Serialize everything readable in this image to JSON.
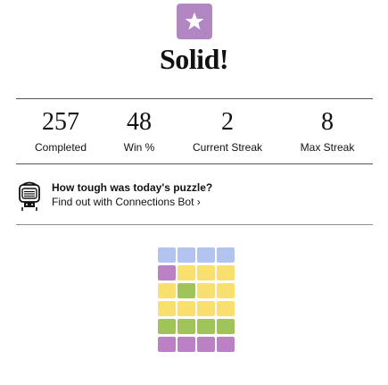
{
  "colors": {
    "yellow": "#f9df6d",
    "green": "#a0c35a",
    "blue": "#b0c4ef",
    "purple": "#ba81c5",
    "badge": "#b286c3"
  },
  "badge": {
    "icon": "star-icon"
  },
  "result_title": "Solid!",
  "stats": [
    {
      "value": "257",
      "label": "Completed"
    },
    {
      "value": "48",
      "label": "Win %"
    },
    {
      "value": "2",
      "label": "Current Streak"
    },
    {
      "value": "8",
      "label": "Max Streak"
    }
  ],
  "bot": {
    "icon": "robot-icon",
    "question": "How tough was today's puzzle?",
    "link_text": "Find out with Connections Bot ›"
  },
  "guess_grid": [
    [
      "blue",
      "blue",
      "blue",
      "blue"
    ],
    [
      "purple",
      "yellow",
      "yellow",
      "yellow"
    ],
    [
      "yellow",
      "green",
      "yellow",
      "yellow"
    ],
    [
      "yellow",
      "yellow",
      "yellow",
      "yellow"
    ],
    [
      "green",
      "green",
      "green",
      "green"
    ],
    [
      "purple",
      "purple",
      "purple",
      "purple"
    ]
  ]
}
